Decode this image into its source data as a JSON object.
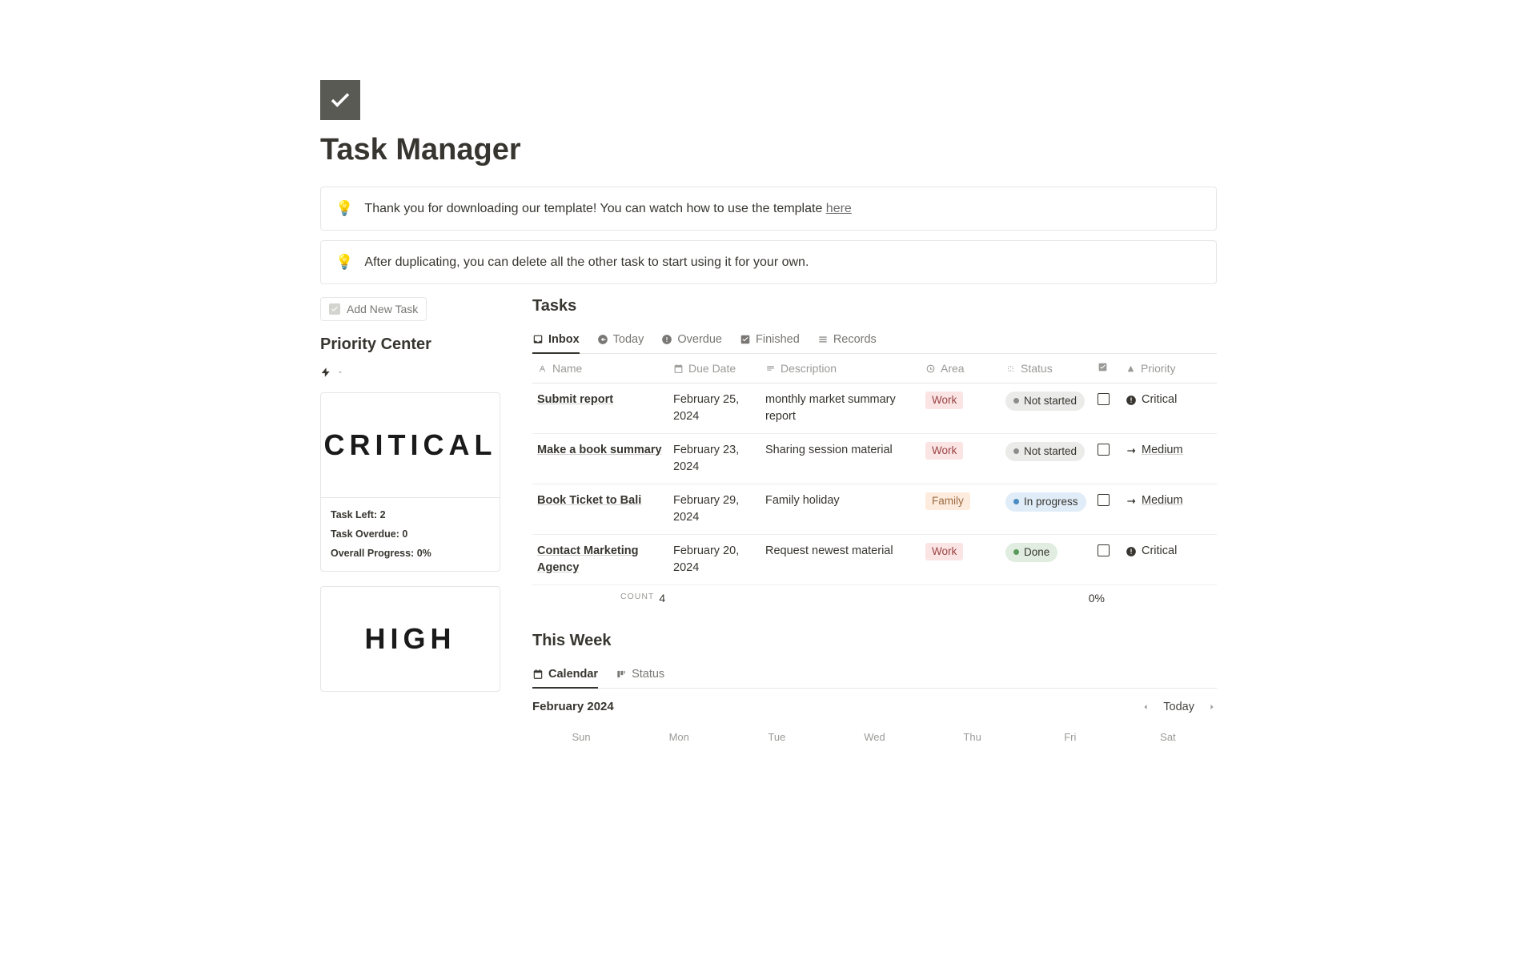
{
  "page": {
    "title": "Task Manager",
    "callout1_text": "Thank you for downloading our template! You can watch how to use the template ",
    "callout1_link": "here",
    "callout2_text": "After duplicating, you can delete all the other task to start using it for your own."
  },
  "sidebar": {
    "add_task_label": "Add New Task",
    "priority_title": "Priority Center",
    "cards": [
      {
        "label": "CRITICAL",
        "task_left": "Task Left: 2",
        "task_overdue": "Task Overdue: 0",
        "progress": "Overall Progress: 0%"
      },
      {
        "label": "HIGH"
      }
    ]
  },
  "tasks": {
    "section_title": "Tasks",
    "tabs": [
      "Inbox",
      "Today",
      "Overdue",
      "Finished",
      "Records"
    ],
    "columns": {
      "name": "Name",
      "due": "Due Date",
      "desc": "Description",
      "area": "Area",
      "status": "Status",
      "priority": "Priority"
    },
    "rows": [
      {
        "name": "Submit report",
        "due": "February 25, 2024",
        "desc": "monthly market summary report",
        "area": "Work",
        "area_class": "tag-work",
        "status": "Not started",
        "status_class": "status-notstarted",
        "priority": "Critical",
        "priority_type": "critical"
      },
      {
        "name": "Make a book summary",
        "due": "February 23, 2024",
        "desc": "Sharing session material",
        "area": "Work",
        "area_class": "tag-work",
        "status": "Not started",
        "status_class": "status-notstarted",
        "priority": "Medium",
        "priority_type": "medium"
      },
      {
        "name": "Book Ticket to Bali",
        "due": "February 29, 2024",
        "desc": "Family holiday",
        "area": "Family",
        "area_class": "tag-family",
        "status": "In progress",
        "status_class": "status-progress",
        "priority": "Medium",
        "priority_type": "medium"
      },
      {
        "name": "Contact Marketing Agency",
        "due": "February 20, 2024",
        "desc": "Request newest material",
        "area": "Work",
        "area_class": "tag-work",
        "status": "Done",
        "status_class": "status-done",
        "priority": "Critical",
        "priority_type": "critical"
      }
    ],
    "footer": {
      "count_label": "COUNT",
      "count_val": "4",
      "pct": "0%"
    }
  },
  "this_week": {
    "title": "This Week",
    "tabs": [
      "Calendar",
      "Status"
    ],
    "month": "February 2024",
    "today_label": "Today",
    "days": [
      "Sun",
      "Mon",
      "Tue",
      "Wed",
      "Thu",
      "Fri",
      "Sat"
    ]
  }
}
